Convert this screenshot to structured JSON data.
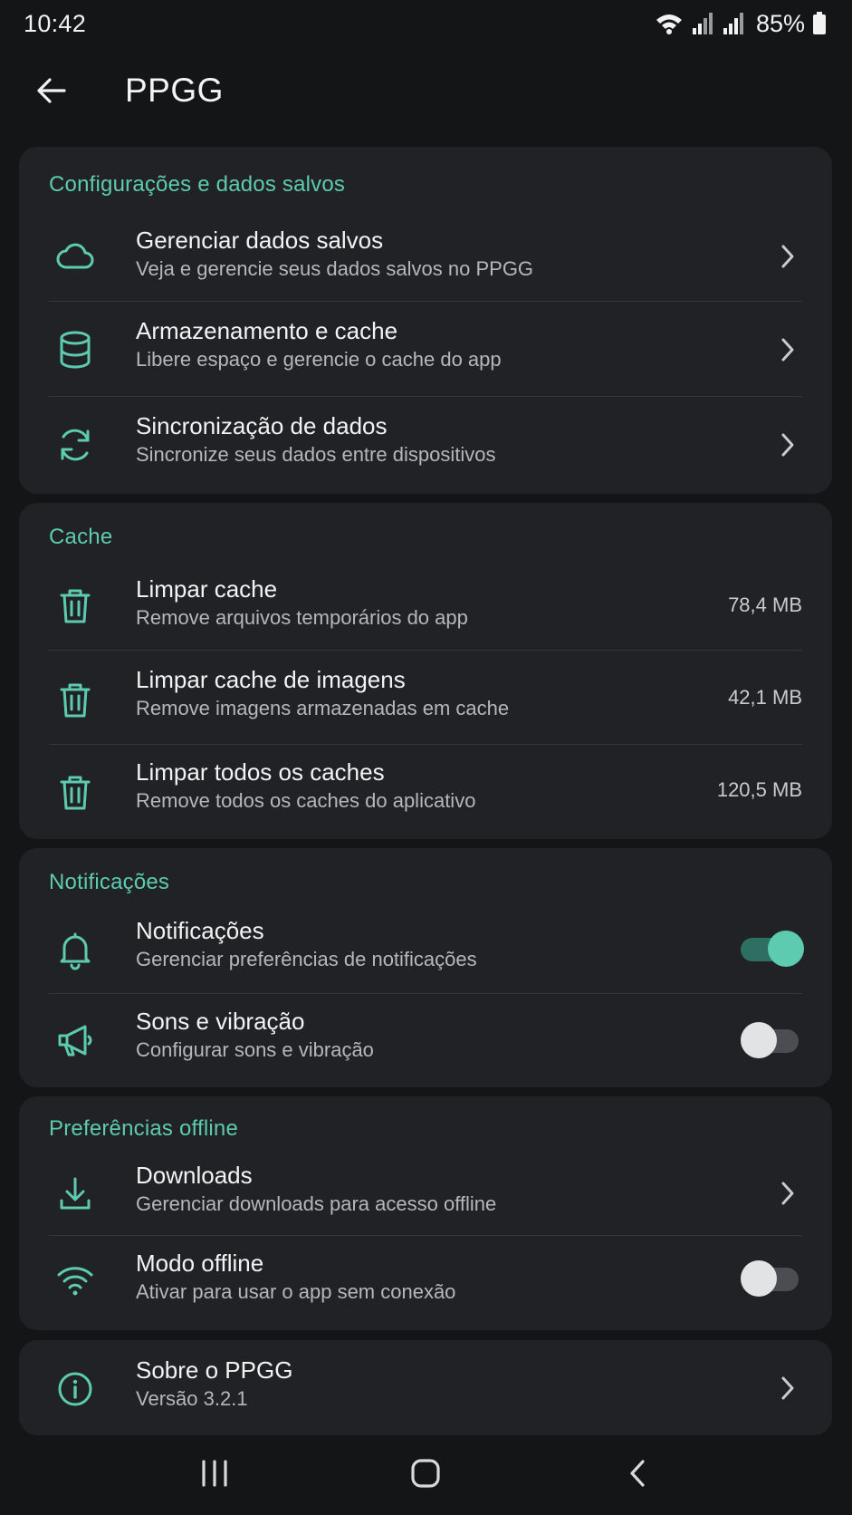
{
  "status_bar": {
    "time": "10:42",
    "battery": "85%"
  },
  "app_bar": {
    "title": "PPGG"
  },
  "colors": {
    "accent": "#5dcbb0",
    "background": "#141517",
    "card": "#202226"
  },
  "sections": {
    "data": {
      "title": "Configurações e dados salvos",
      "items": [
        {
          "icon": "cloud-icon",
          "title": "Gerenciar dados salvos",
          "subtitle": "Veja e gerencie seus dados salvos no PPGG"
        },
        {
          "icon": "database-icon",
          "title": "Armazenamento e cache",
          "subtitle": "Libere espaço e gerencie o cache do app"
        },
        {
          "icon": "sync-icon",
          "title": "Sincronização de dados",
          "subtitle": "Sincronize seus dados entre dispositivos"
        }
      ]
    },
    "cache": {
      "title": "Cache",
      "items": [
        {
          "icon": "trash-icon",
          "title": "Limpar cache",
          "subtitle": "Remove arquivos temporários do app",
          "value": "78,4 MB"
        },
        {
          "icon": "trash-icon",
          "title": "Limpar cache de imagens",
          "subtitle": "Remove imagens armazenadas em cache",
          "value": "42,1 MB"
        },
        {
          "icon": "trash-icon",
          "title": "Limpar todos os caches",
          "subtitle": "Remove todos os caches do aplicativo",
          "value": "120,5 MB"
        }
      ]
    },
    "notifications": {
      "title": "Notificações",
      "items": [
        {
          "icon": "bell-icon",
          "title": "Notificações",
          "subtitle": "Gerenciar preferências de notificações",
          "enabled": true
        },
        {
          "icon": "megaphone-icon",
          "title": "Sons e vibração",
          "subtitle": "Configurar sons e vibração",
          "enabled": false
        }
      ]
    },
    "offline": {
      "title": "Preferências offline",
      "items": [
        {
          "icon": "download-icon",
          "title": "Downloads",
          "subtitle": "Gerenciar downloads para acesso offline"
        },
        {
          "icon": "wifi-icon",
          "title": "Modo offline",
          "subtitle": "Ativar para usar o app sem conexão",
          "enabled": false
        }
      ]
    },
    "about": {
      "items": [
        {
          "icon": "info-icon",
          "title": "Sobre o PPGG",
          "subtitle": "Versão 3.2.1"
        }
      ]
    }
  },
  "nav_bar": {
    "items": [
      "recents-icon",
      "home-icon",
      "back-icon"
    ]
  }
}
